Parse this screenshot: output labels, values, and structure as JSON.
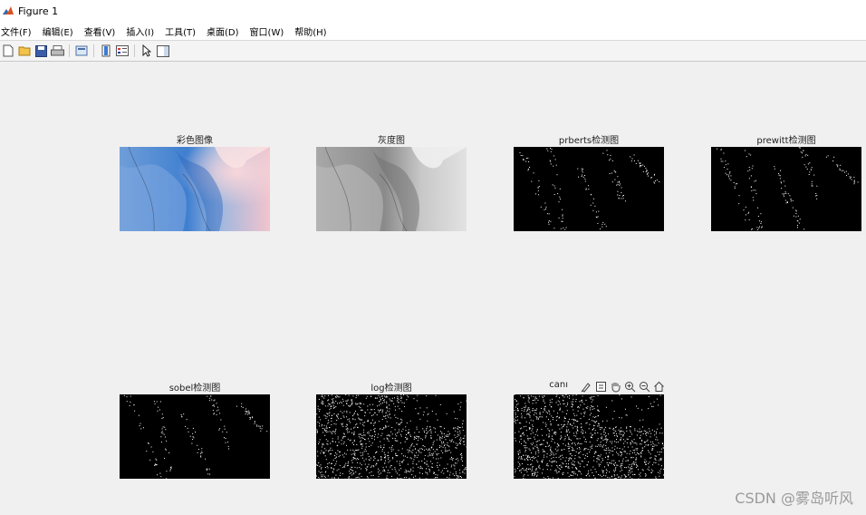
{
  "window": {
    "title": "Figure 1"
  },
  "menu": [
    "文件(F)",
    "编辑(E)",
    "查看(V)",
    "插入(I)",
    "工具(T)",
    "桌面(D)",
    "窗口(W)",
    "帮助(H)"
  ],
  "plots": {
    "color": "彩色图像",
    "gray": "灰度图",
    "roberts": "prberts检测图",
    "prewitt": "prewitt检测图",
    "sobel": "sobel检测图",
    "log": "log检测图",
    "canny": "canı"
  },
  "watermark": "CSDN @雾岛听风"
}
